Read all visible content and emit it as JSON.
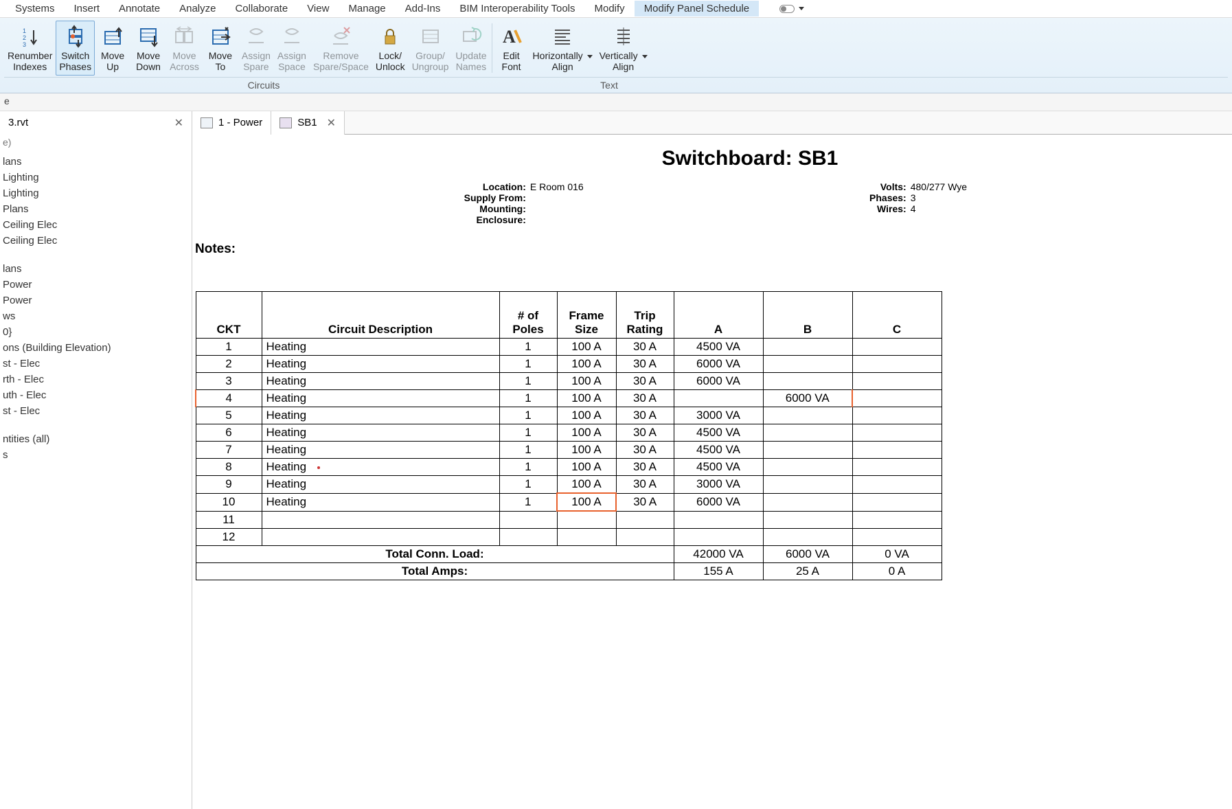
{
  "menu": {
    "items": [
      "Systems",
      "Insert",
      "Annotate",
      "Analyze",
      "Collaborate",
      "View",
      "Manage",
      "Add-Ins",
      "BIM Interoperability Tools",
      "Modify",
      "Modify Panel Schedule"
    ]
  },
  "ribbon": {
    "buttons": [
      {
        "l1": "Renumber",
        "l2": "Indexes",
        "icon": "renumber"
      },
      {
        "l1": "Switch",
        "l2": "Phases",
        "icon": "switch-phases",
        "selected": true
      },
      {
        "l1": "Move",
        "l2": "Up",
        "icon": "move-up"
      },
      {
        "l1": "Move",
        "l2": "Down",
        "icon": "move-down"
      },
      {
        "l1": "Move",
        "l2": "Across",
        "icon": "move-across",
        "disabled": true
      },
      {
        "l1": "Move",
        "l2": "To",
        "icon": "move-to"
      },
      {
        "l1": "Assign",
        "l2": "Spare",
        "icon": "assign-spare",
        "disabled": true
      },
      {
        "l1": "Assign",
        "l2": "Space",
        "icon": "assign-space",
        "disabled": true
      },
      {
        "l1": "Remove",
        "l2": "Spare/Space",
        "icon": "remove-spare",
        "disabled": true
      },
      {
        "l1": "Lock/",
        "l2": "Unlock",
        "icon": "lock"
      },
      {
        "l1": "Group/",
        "l2": "Ungroup",
        "icon": "group",
        "disabled": true
      },
      {
        "l1": "Update",
        "l2": "Names",
        "icon": "update-names",
        "disabled": true
      },
      {
        "l1": "Edit",
        "l2": "Font",
        "icon": "font"
      },
      {
        "l1": "Horizontally",
        "l2": "Align",
        "icon": "halign",
        "dropdown": true
      },
      {
        "l1": "Vertically",
        "l2": "Align",
        "icon": "valign",
        "dropdown": true
      }
    ],
    "groups": {
      "circuits": "Circuits",
      "text": "Text"
    }
  },
  "side": {
    "small_row_text": "e",
    "tabs": {
      "project": "3.rvt",
      "power": "1 - Power",
      "sb1": "SB1"
    },
    "second_row": "e)"
  },
  "tree": {
    "items": [
      "lans",
      "Lighting",
      "Lighting",
      "Plans",
      "Ceiling Elec",
      "Ceiling Elec",
      "",
      "lans",
      "Power",
      "Power",
      "ws",
      "0}",
      "ons (Building Elevation)",
      "st - Elec",
      "rth - Elec",
      "uth - Elec",
      "st - Elec",
      "",
      "ntities (all)",
      "s"
    ]
  },
  "panel": {
    "title": "Switchboard: SB1",
    "location_label": "Location:",
    "location_value": "E Room 016",
    "supply_label": "Supply From:",
    "supply_value": "",
    "mounting_label": "Mounting:",
    "mounting_value": "",
    "enclosure_label": "Enclosure:",
    "enclosure_value": "",
    "volts_label": "Volts:",
    "volts_value": "480/277 Wye",
    "phases_label": "Phases:",
    "phases_value": "3",
    "wires_label": "Wires:",
    "wires_value": "4",
    "notes_label": "Notes:"
  },
  "table": {
    "headers": {
      "ckt": "CKT",
      "desc": "Circuit Description",
      "poles": "# of Poles",
      "frame": "Frame Size",
      "trip": "Trip Rating",
      "a": "A",
      "b": "B",
      "c": "C"
    },
    "rows": [
      {
        "ckt": "1",
        "desc": "Heating",
        "poles": "1",
        "frame": "100 A",
        "trip": "30 A",
        "a": "4500 VA",
        "b": "",
        "c": ""
      },
      {
        "ckt": "2",
        "desc": "Heating",
        "poles": "1",
        "frame": "100 A",
        "trip": "30 A",
        "a": "6000 VA",
        "b": "",
        "c": ""
      },
      {
        "ckt": "3",
        "desc": "Heating",
        "poles": "1",
        "frame": "100 A",
        "trip": "30 A",
        "a": "6000 VA",
        "b": "",
        "c": ""
      },
      {
        "ckt": "4",
        "desc": "Heating",
        "poles": "1",
        "frame": "100 A",
        "trip": "30 A",
        "a": "",
        "b": "6000 VA",
        "c": "",
        "highlight": true
      },
      {
        "ckt": "5",
        "desc": "Heating",
        "poles": "1",
        "frame": "100 A",
        "trip": "30 A",
        "a": "3000 VA",
        "b": "",
        "c": ""
      },
      {
        "ckt": "6",
        "desc": "Heating",
        "poles": "1",
        "frame": "100 A",
        "trip": "30 A",
        "a": "4500 VA",
        "b": "",
        "c": ""
      },
      {
        "ckt": "7",
        "desc": "Heating",
        "poles": "1",
        "frame": "100 A",
        "trip": "30 A",
        "a": "4500 VA",
        "b": "",
        "c": ""
      },
      {
        "ckt": "8",
        "desc": "Heating",
        "poles": "1",
        "frame": "100 A",
        "trip": "30 A",
        "a": "4500 VA",
        "b": "",
        "c": "",
        "reddot": true
      },
      {
        "ckt": "9",
        "desc": "Heating",
        "poles": "1",
        "frame": "100 A",
        "trip": "30 A",
        "a": "3000 VA",
        "b": "",
        "c": ""
      },
      {
        "ckt": "10",
        "desc": "Heating",
        "poles": "1",
        "frame": "100 A",
        "trip": "30 A",
        "a": "6000 VA",
        "b": "",
        "c": "",
        "frame_hl": true
      },
      {
        "ckt": "11",
        "desc": "",
        "poles": "",
        "frame": "",
        "trip": "",
        "a": "",
        "b": "",
        "c": ""
      },
      {
        "ckt": "12",
        "desc": "",
        "poles": "",
        "frame": "",
        "trip": "",
        "a": "",
        "b": "",
        "c": ""
      }
    ],
    "totals": {
      "conn_load_label": "Total Conn. Load:",
      "conn_load": {
        "a": "42000 VA",
        "b": "6000 VA",
        "c": "0 VA"
      },
      "amps_label": "Total Amps:",
      "amps": {
        "a": "155 A",
        "b": "25 A",
        "c": "0 A"
      }
    }
  }
}
